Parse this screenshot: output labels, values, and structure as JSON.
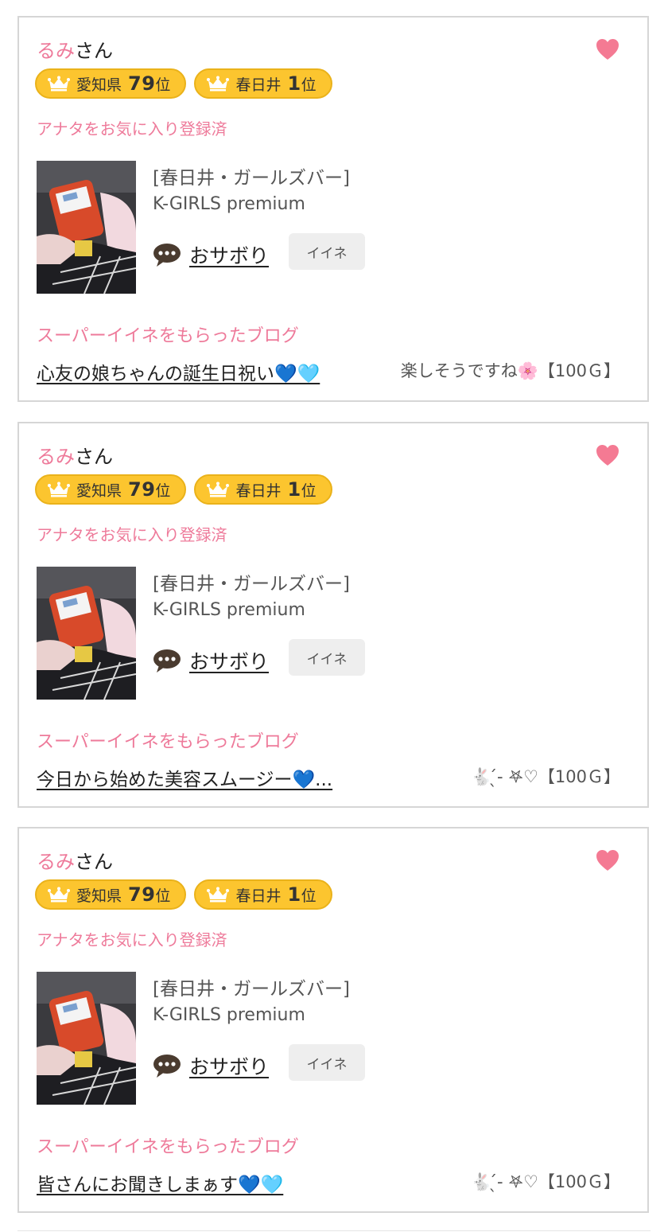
{
  "colors": {
    "accent_pink": "#ee7a9a",
    "badge_yellow": "#fcc52f",
    "border": "#d6d6d6"
  },
  "cards": [
    {
      "name": "るみ",
      "suffix": "さん",
      "badges": [
        {
          "label": "愛知県",
          "rank": "79",
          "unit": "位"
        },
        {
          "label": "春日井",
          "rank": "1",
          "unit": "位"
        }
      ],
      "favorite_text": "アナタをお気に入り登録済",
      "shop_category": "[春日井・ガールズバー]",
      "shop_name": "K-GIRLS premium",
      "status": "おサボり",
      "iine_label": "イイネ",
      "super_label": "スーパーイイネをもらったブログ",
      "blog_title": "心友の娘ちゃんの誕生日祝い💙🩵",
      "comment": "楽しそうですね🌸【100Ｇ】"
    },
    {
      "name": "るみ",
      "suffix": "さん",
      "badges": [
        {
          "label": "愛知県",
          "rank": "79",
          "unit": "位"
        },
        {
          "label": "春日井",
          "rank": "1",
          "unit": "位"
        }
      ],
      "favorite_text": "アナタをお気に入り登録済",
      "shop_category": "[春日井・ガールズバー]",
      "shop_name": "K-GIRLS premium",
      "status": "おサボり",
      "iine_label": "イイネ",
      "super_label": "スーパーイイネをもらったブログ",
      "blog_title": "今日から始めた美容スムージー💙...",
      "comment": "🐇 ̖́-‌ 𖤐♡【100Ｇ】"
    },
    {
      "name": "るみ",
      "suffix": "さん",
      "badges": [
        {
          "label": "愛知県",
          "rank": "79",
          "unit": "位"
        },
        {
          "label": "春日井",
          "rank": "1",
          "unit": "位"
        }
      ],
      "favorite_text": "アナタをお気に入り登録済",
      "shop_category": "[春日井・ガールズバー]",
      "shop_name": "K-GIRLS premium",
      "status": "おサボり",
      "iine_label": "イイネ",
      "super_label": "スーパーイイネをもらったブログ",
      "blog_title": "皆さんにお聞きしまぁす💙🩵",
      "comment": "🐇 ̖́-‌ 𖤐♡【100Ｇ】"
    }
  ]
}
